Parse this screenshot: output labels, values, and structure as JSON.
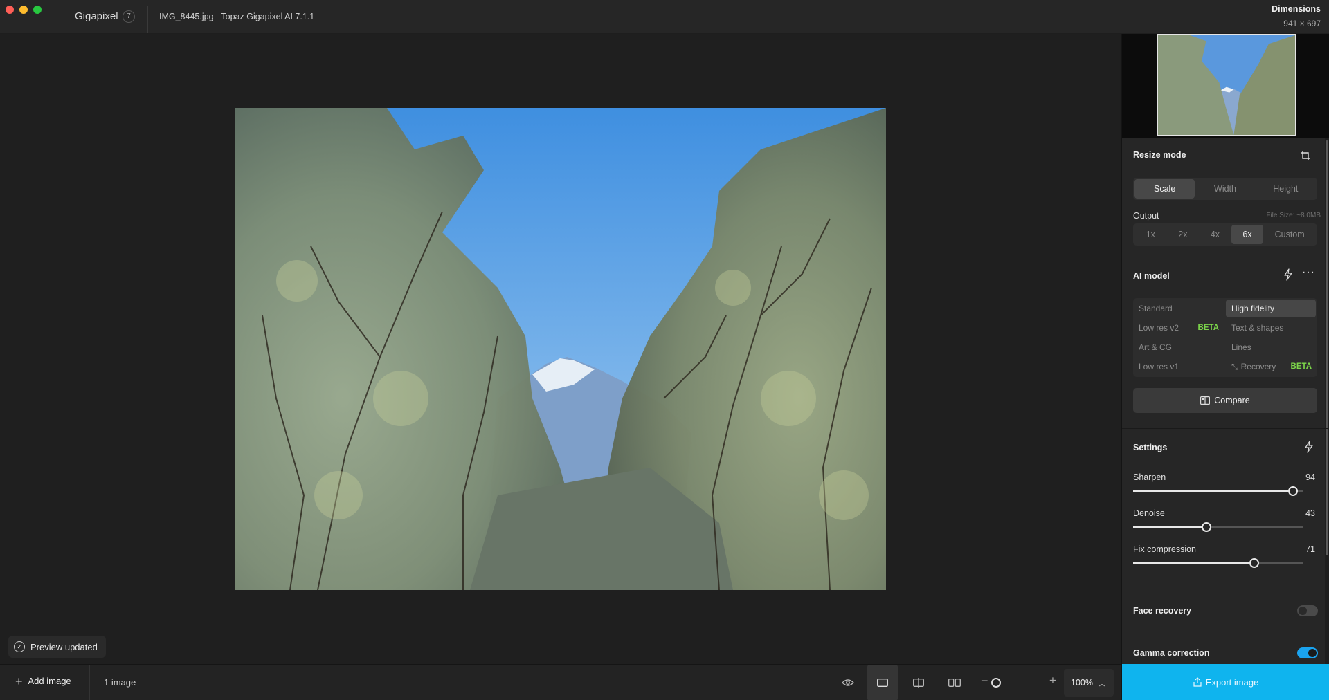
{
  "window": {
    "app_name": "Gigapixel",
    "app_badge": "7",
    "file_title": "IMG_8445.jpg - Topaz Gigapixel AI 7.1.1",
    "dimensions_label": "Dimensions",
    "dimensions_value": "941 × 697"
  },
  "canvas": {
    "toast": "Preview updated"
  },
  "bottombar": {
    "add_image": "Add image",
    "image_count": "1 image",
    "zoom": "100%",
    "icons": [
      "eye-icon",
      "single-view-icon",
      "split-view-icon",
      "side-by-side-icon"
    ]
  },
  "panel": {
    "resize_mode": {
      "title": "Resize mode",
      "tabs": [
        "Scale",
        "Width",
        "Height"
      ],
      "selected": "Scale"
    },
    "output": {
      "label": "Output",
      "file_size": "File Size: ~8.0MB",
      "options": [
        "1x",
        "2x",
        "4x",
        "6x",
        "Custom"
      ],
      "selected": "6x"
    },
    "ai_model": {
      "title": "AI model",
      "models": {
        "standard": "Standard",
        "high_fidelity": "High fidelity",
        "low_res_v2": "Low res v2",
        "text_shapes": "Text & shapes",
        "art_cg": "Art & CG",
        "lines": "Lines",
        "low_res_v1": "Low res v1",
        "recovery": "Recovery"
      },
      "beta": "BETA",
      "selected": "High fidelity",
      "compare": "Compare"
    },
    "settings": {
      "title": "Settings",
      "sharpen": {
        "label": "Sharpen",
        "value": "94",
        "fraction": 0.94
      },
      "denoise": {
        "label": "Denoise",
        "value": "43",
        "fraction": 0.43
      },
      "fix_compression": {
        "label": "Fix compression",
        "value": "71",
        "fraction": 0.71
      }
    },
    "face_recovery": {
      "label": "Face recovery",
      "on": false
    },
    "gamma_correction": {
      "label": "Gamma correction",
      "on": true
    },
    "export": "Export image"
  },
  "colors": {
    "accent": "#0fb4ee",
    "beta": "#7cd64a",
    "toggle_on": "#1aa3ef"
  }
}
